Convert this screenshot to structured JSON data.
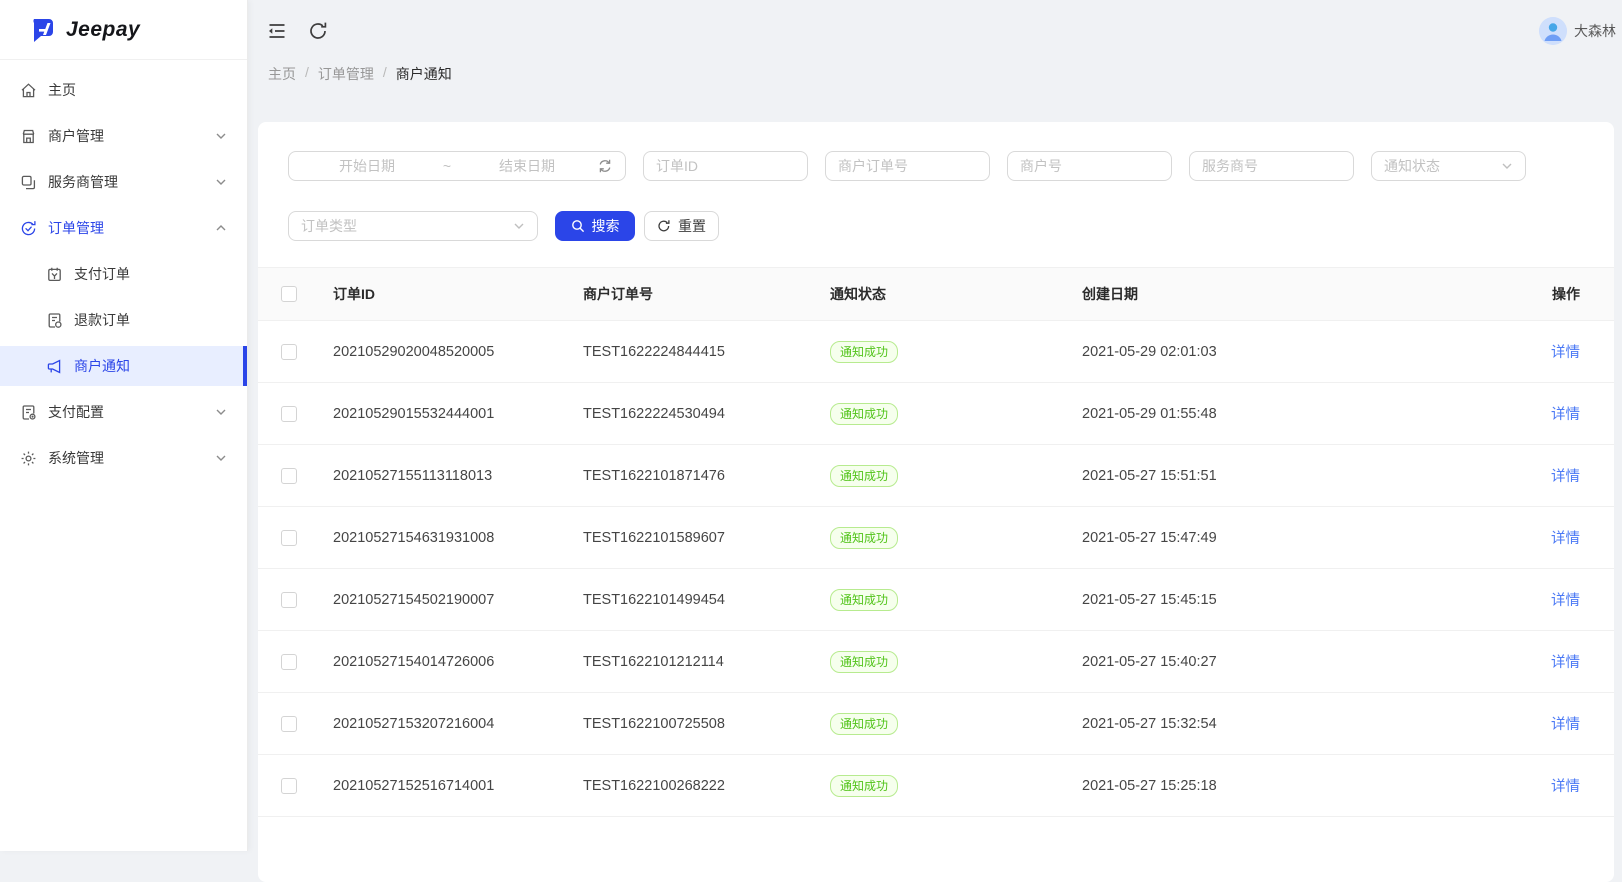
{
  "brand": {
    "name": "Jeepay"
  },
  "topbar": {
    "username": "大森林"
  },
  "breadcrumb": {
    "items": [
      "主页",
      "订单管理",
      "商户通知"
    ],
    "separator": "/"
  },
  "sidebar": {
    "items": [
      {
        "label": "主页",
        "icon": "home-icon"
      },
      {
        "label": "商户管理",
        "icon": "shop-icon",
        "expandable": true
      },
      {
        "label": "服务商管理",
        "icon": "cluster-icon",
        "expandable": true
      },
      {
        "label": "订单管理",
        "icon": "transaction-icon",
        "expandable": true,
        "expanded": true,
        "active": true,
        "children": [
          {
            "label": "支付订单",
            "icon": "pay-order-icon"
          },
          {
            "label": "退款订单",
            "icon": "refund-order-icon"
          },
          {
            "label": "商户通知",
            "icon": "notify-icon",
            "active": true
          }
        ]
      },
      {
        "label": "支付配置",
        "icon": "pay-config-icon",
        "expandable": true
      },
      {
        "label": "系统管理",
        "icon": "setting-icon",
        "expandable": true
      }
    ]
  },
  "filters": {
    "date_start_placeholder": "开始日期",
    "date_separator": "~",
    "date_end_placeholder": "结束日期",
    "order_id_placeholder": "订单ID",
    "mch_order_no_placeholder": "商户订单号",
    "mch_no_placeholder": "商户号",
    "isv_no_placeholder": "服务商号",
    "notify_state_placeholder": "通知状态",
    "order_type_placeholder": "订单类型",
    "search_label": "搜索",
    "reset_label": "重置"
  },
  "table": {
    "headers": {
      "order_id": "订单ID",
      "mch_order_no": "商户订单号",
      "state": "通知状态",
      "created": "创建日期",
      "ops": "操作"
    },
    "detail_label": "详情",
    "rows": [
      {
        "order_id": "20210529020048520005",
        "mch_order_no": "TEST1622224844415",
        "state": "通知成功",
        "created": "2021-05-29 02:01:03"
      },
      {
        "order_id": "20210529015532444001",
        "mch_order_no": "TEST1622224530494",
        "state": "通知成功",
        "created": "2021-05-29 01:55:48"
      },
      {
        "order_id": "20210527155113118013",
        "mch_order_no": "TEST1622101871476",
        "state": "通知成功",
        "created": "2021-05-27 15:51:51"
      },
      {
        "order_id": "20210527154631931008",
        "mch_order_no": "TEST1622101589607",
        "state": "通知成功",
        "created": "2021-05-27 15:47:49"
      },
      {
        "order_id": "20210527154502190007",
        "mch_order_no": "TEST1622101499454",
        "state": "通知成功",
        "created": "2021-05-27 15:45:15"
      },
      {
        "order_id": "20210527154014726006",
        "mch_order_no": "TEST1622101212114",
        "state": "通知成功",
        "created": "2021-05-27 15:40:27"
      },
      {
        "order_id": "20210527153207216004",
        "mch_order_no": "TEST1622100725508",
        "state": "通知成功",
        "created": "2021-05-27 15:32:54"
      },
      {
        "order_id": "20210527152516714001",
        "mch_order_no": "TEST1622100268222",
        "state": "通知成功",
        "created": "2021-05-27 15:25:18"
      }
    ]
  },
  "colors": {
    "primary": "#2b45e8",
    "link": "#4b79f5",
    "success_text": "#52c41a",
    "success_bg": "#f6ffed",
    "success_border": "#b7eb8f",
    "page_bg": "#f0f2f5",
    "active_menu_bg": "#e8eeff"
  }
}
